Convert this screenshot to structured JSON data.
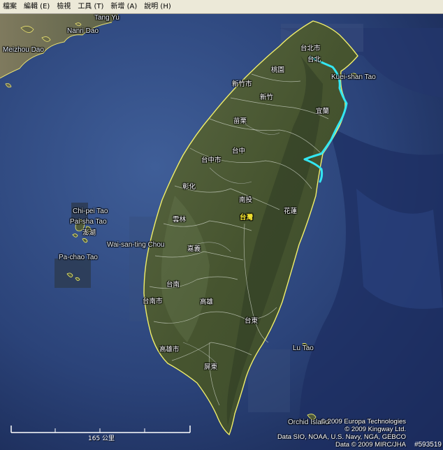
{
  "menu": {
    "items": [
      "檔案",
      "編輯 (E)",
      "檢視",
      "工具 (T)",
      "新增 (A)",
      "說明 (H)"
    ]
  },
  "map": {
    "places_en": {
      "tang_yu": "Tang Yu",
      "nanri_dao": "Nanri Dao",
      "meizhou_dao": "Meizhou Dao",
      "kuei_shan_tao": "Kuei-shan Tao",
      "chi_pei_tao": "Chi-pei Tao",
      "pai_sha_tao": "Pai-sha Tao",
      "wai_san_ting_chou": "Wai-san-ting Chou",
      "pa_chao_tao": "Pa-chao Tao",
      "lu_tao": "Lu Tao",
      "orchid_island": "Orchid Island"
    },
    "places_cn": {
      "taipei_city": "台北市",
      "taipei": "台北",
      "taoyuan": "桃園",
      "hsinchu_city": "新竹市",
      "hsinchu": "新竹",
      "yilan": "宜蘭",
      "miaoli": "苗栗",
      "taichung": "台中",
      "taichung_city": "台中市",
      "changhua": "彰化",
      "nantou": "南投",
      "taiwan": "台灣",
      "hualien": "花蓮",
      "yunlin": "雲林",
      "penghu": "澎湖",
      "chiayi": "嘉義",
      "tainan": "台南",
      "tainan_city": "台南市",
      "kaohsiung": "高雄",
      "taitung": "台東",
      "kaohsiung_city": "高雄市",
      "pingtung": "屏東"
    },
    "scale_label": "165 公里",
    "attribution": [
      "© 2009 Europa Technologies",
      "© 2009 Kingway Ltd.",
      "Data SIO, NOAA, U.S. Navy, NGA, GEBCO",
      "Data © 2009 MIRC/JHA"
    ],
    "image_id": "#593519"
  },
  "colors": {
    "ocean_deep": "#1b2b5c",
    "ocean_shallow": "#3c5a94",
    "land": "#4a5a36",
    "coast": "#f0ee6a",
    "route": "#33e6f2",
    "menubar": "#ece9d8"
  }
}
